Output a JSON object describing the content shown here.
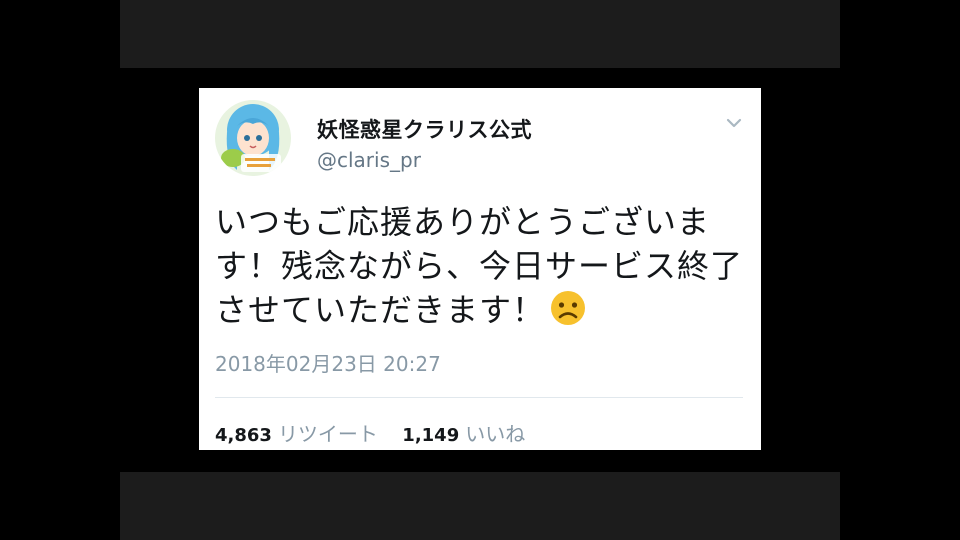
{
  "tweet": {
    "display_name": "妖怪惑星クラリス公式",
    "handle": "@claris_pr",
    "text": "いつもご応援ありがとうございます！残念ながら、今日サービス終了させていただきます！",
    "emoji_icon": "frowning-face-icon",
    "timestamp": "2018年02月23日 20:27",
    "retweets": {
      "count": "4,863",
      "label": "リツイート"
    },
    "likes": {
      "count": "1,149",
      "label": "いいね"
    }
  },
  "colors": {
    "background": "#000000",
    "band": "#1c1c1c",
    "card": "#ffffff",
    "name": "#14171a",
    "muted": "#657786",
    "emoji": "#f7c12d"
  }
}
